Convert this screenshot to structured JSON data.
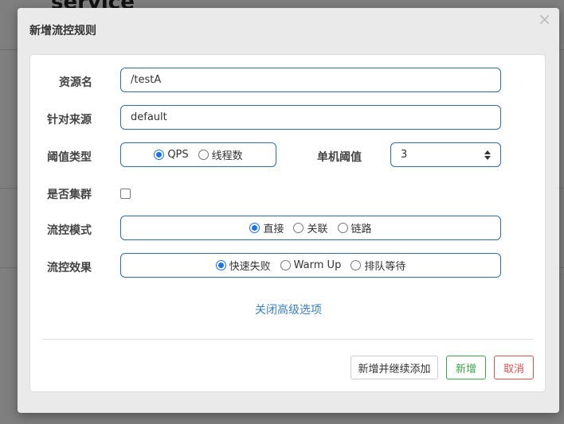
{
  "background": {
    "page_title": "service"
  },
  "modal": {
    "title": "新增流控规则",
    "close_glyph": "×",
    "fields": {
      "resource_label": "资源名",
      "resource_value": "/testA",
      "origin_label": "针对来源",
      "origin_value": "default",
      "threshold_type_label": "阈值类型",
      "threshold_type_options": [
        "QPS",
        "线程数"
      ],
      "threshold_type_selected": "QPS",
      "single_threshold_label": "单机阈值",
      "single_threshold_value": "3",
      "cluster_label": "是否集群",
      "cluster_checked": false,
      "flow_mode_label": "流控模式",
      "flow_mode_options": [
        "直接",
        "关联",
        "链路"
      ],
      "flow_mode_selected": "直接",
      "flow_effect_label": "流控效果",
      "flow_effect_options": [
        "快速失败",
        "Warm Up",
        "排队等待"
      ],
      "flow_effect_selected": "快速失败"
    },
    "advanced_link": "关闭高级选项",
    "buttons": {
      "add_continue": "新增并继续添加",
      "add": "新增",
      "cancel": "取消"
    }
  },
  "colors": {
    "accent_blue": "#1a73e8",
    "link_blue": "#3a7fc4",
    "success_green": "#3aa54a",
    "danger_red": "#d9534f",
    "field_border": "#2c6da5"
  }
}
